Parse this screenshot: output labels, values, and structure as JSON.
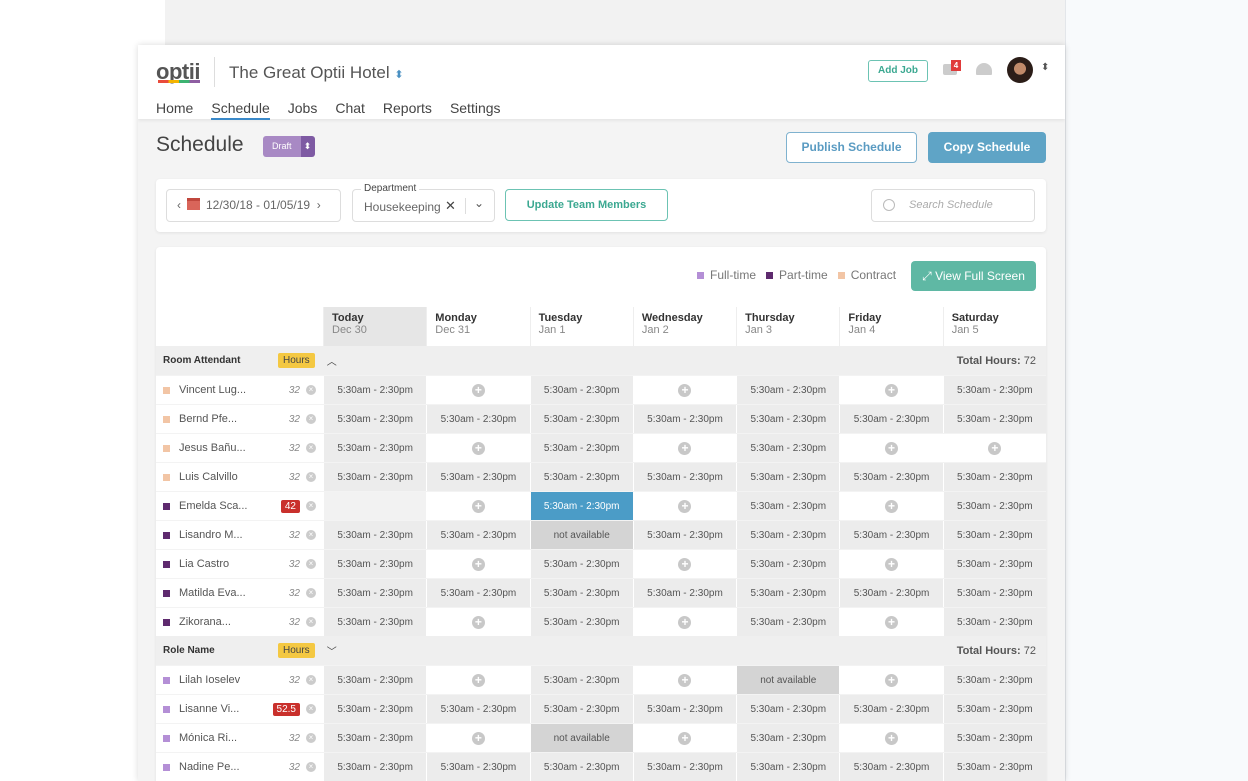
{
  "app": {
    "logo": "optii",
    "hotel": "The Great Optii Hotel",
    "add_job": "Add Job",
    "chat_badge": "4"
  },
  "nav": [
    "Home",
    "Schedule",
    "Jobs",
    "Chat",
    "Reports",
    "Settings"
  ],
  "page": {
    "title": "Schedule",
    "status": "Draft",
    "publish": "Publish Schedule",
    "copy": "Copy Schedule"
  },
  "filters": {
    "date_range": "12/30/18 - 01/05/19",
    "department_label": "Department",
    "department": "Housekeeping",
    "update": "Update Team Members",
    "search_placeholder": "Search Schedule"
  },
  "legend": [
    {
      "label": "Full-time",
      "color": "#b48fd6"
    },
    {
      "label": "Part-time",
      "color": "#5e2a6e"
    },
    {
      "label": "Contract",
      "color": "#f2c5a5"
    }
  ],
  "view_full_screen": "View Full Screen",
  "days": [
    {
      "day": "Today",
      "date": "Dec 30"
    },
    {
      "day": "Monday",
      "date": "Dec 31"
    },
    {
      "day": "Tuesday",
      "date": "Jan 1"
    },
    {
      "day": "Wednesday",
      "date": "Jan 2"
    },
    {
      "day": "Thursday",
      "date": "Jan 3"
    },
    {
      "day": "Friday",
      "date": "Jan 4"
    },
    {
      "day": "Saturday",
      "date": "Jan 5"
    }
  ],
  "shift": "5:30am - 2:30pm",
  "not_available": "not available",
  "hours_label": "Hours",
  "total_label": "Total Hours:",
  "groups": [
    {
      "name": "Room Attendant",
      "total": "72",
      "expanded": true,
      "rows": [
        {
          "name": "Vincent Lug...",
          "hours": "32",
          "type": "contract",
          "cells": "SPSPSPS"
        },
        {
          "name": "Bernd Pfe...",
          "hours": "32",
          "type": "contract",
          "cells": "SSSSSSS"
        },
        {
          "name": "Jesus Bañu...",
          "hours": "32",
          "type": "contract",
          "cells": "SPSPSPP"
        },
        {
          "name": "Luis Calvillo",
          "hours": "32",
          "type": "contract",
          "cells": "SSSSSSS"
        },
        {
          "name": "Emelda Sca...",
          "hours": "42",
          "over": true,
          "type": "part",
          "cells": "EPHPSPS"
        },
        {
          "name": "Lisandro M...",
          "hours": "32",
          "type": "part",
          "cells": "SSNSSSS"
        },
        {
          "name": "Lia Castro",
          "hours": "32",
          "type": "part",
          "cells": "SPSPSPS"
        },
        {
          "name": "Matilda Eva...",
          "hours": "32",
          "type": "part",
          "cells": "SSSSSSS"
        },
        {
          "name": "Zikorana...",
          "hours": "32",
          "type": "part",
          "cells": "SPSPSPS"
        }
      ]
    },
    {
      "name": "Role Name",
      "total": "72",
      "expanded": false,
      "rows": [
        {
          "name": "Lilah Ioselev",
          "hours": "32",
          "type": "full",
          "cells": "SPSPNPS"
        },
        {
          "name": "Lisanne Vi...",
          "hours": "52.5",
          "over": true,
          "type": "full",
          "cells": "SSSSSSS"
        },
        {
          "name": "Mónica Ri...",
          "hours": "32",
          "type": "full",
          "cells": "SPNPSPS"
        },
        {
          "name": "Nadine Pe...",
          "hours": "32",
          "type": "full",
          "cells": "SSSSSSS"
        }
      ]
    }
  ]
}
